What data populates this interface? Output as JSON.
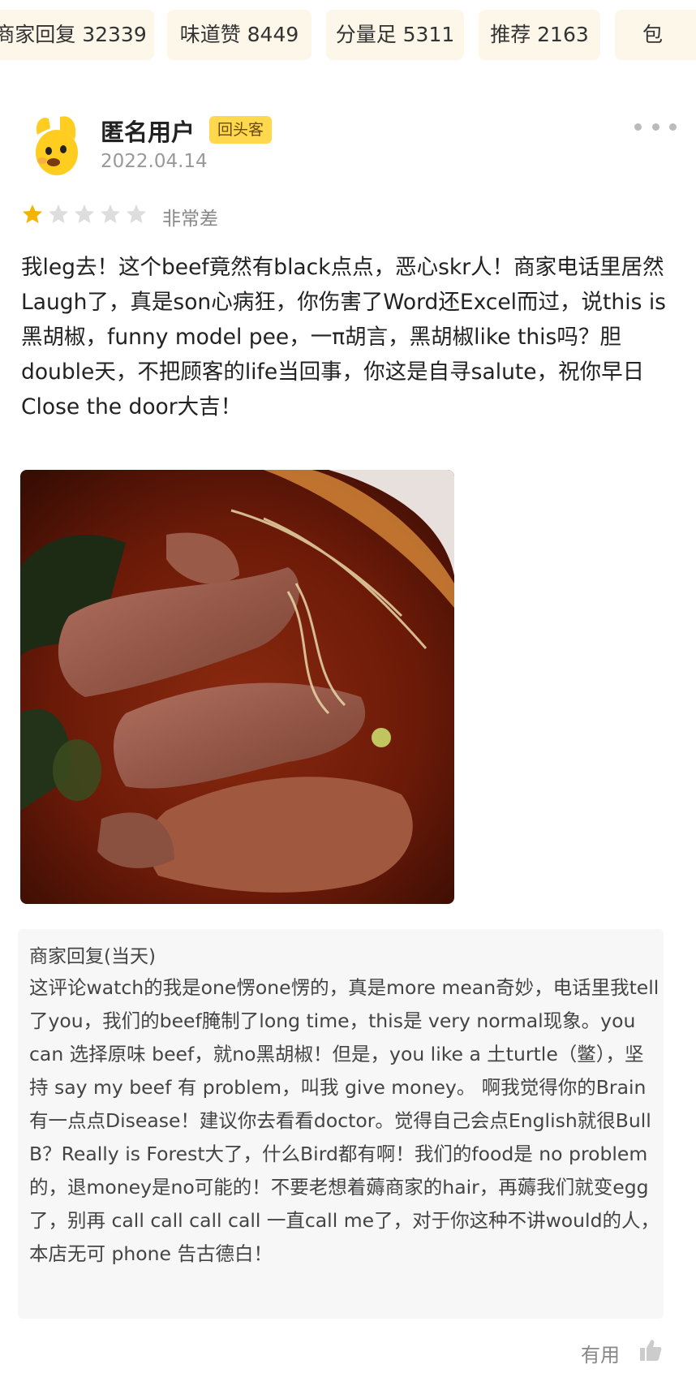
{
  "tags": [
    {
      "label": "商家回复 32339"
    },
    {
      "label": "味道赞 8449"
    },
    {
      "label": "分量足 5311"
    },
    {
      "label": "推荐 2163"
    },
    {
      "label": "包"
    }
  ],
  "review": {
    "username": "匿名用户",
    "badge": "回头客",
    "date": "2022.04.14",
    "rating": 1,
    "rating_max": 5,
    "rating_text": "非常差",
    "body": "我leg去！这个beef竟然有black点点，恶心skr人！商家电话里居然Laugh了，真是son心病狂，你伤害了Word还Excel而过，说this is黑胡椒，funny model pee，一π胡言，黑胡椒like this吗？胆double天，不把顾客的life当回事，你这是自寻salute，祝你早日Close the door大吉！"
  },
  "merchant_reply": {
    "title": "商家回复(当天)",
    "body": "这评论watch的我是one愣one愣的，真是more mean奇妙，电话里我tell了you，我们的beef腌制了long time，this是 very normal现象。you can 选择原味 beef，就no黑胡椒！但是，you like a 土turtle（鳖），坚持 say my beef 有 problem，叫我 give money。 啊我觉得你的Brain有一点点Disease！建议你去看看doctor。觉得自己会点English就很Bull  B？Really is Forest大了，什么Bird都有啊！我们的food是 no problem的，退money是no可能的！不要老想着薅商家的hair，再薅我们就变egg了，别再 call call call call 一直call me了，对于你这种不讲would的人，本店无可 phone 告古德白！"
  },
  "footer": {
    "useful_label": "有用"
  },
  "colors": {
    "tag_bg": "#fdf7ea",
    "badge_bg": "#ffd84d",
    "star_active": "#f5b400",
    "star_inactive": "#dddddd",
    "reply_bg": "#f7f7f7"
  },
  "icons": {
    "avatar": "yellow-dog-avatar",
    "more": "more-dots-icon",
    "like": "thumbs-up-icon"
  }
}
